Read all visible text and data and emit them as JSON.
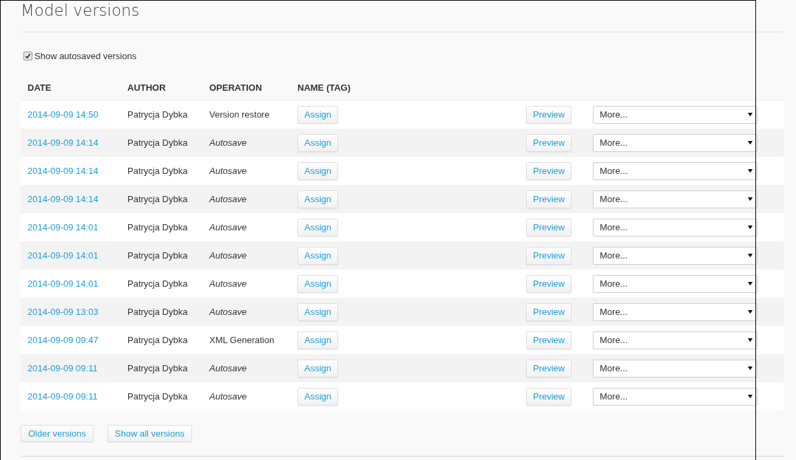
{
  "title": "Model versions",
  "autosave_toggle": {
    "label": "Show autosaved versions",
    "checked": true
  },
  "table": {
    "columns": [
      "DATE",
      "AUTHOR",
      "OPERATION",
      "NAME (TAG)"
    ],
    "rows": [
      {
        "date": "2014-09-09 14:50",
        "author": "Patrycja Dybka",
        "operation": "Version restore",
        "kind": "manual",
        "assign": "Assign",
        "preview": "Preview",
        "more": "More..."
      },
      {
        "date": "2014-09-09 14:14",
        "author": "Patrycja Dybka",
        "operation": "Autosave",
        "kind": "autosave",
        "assign": "Assign",
        "preview": "Preview",
        "more": "More..."
      },
      {
        "date": "2014-09-09 14:14",
        "author": "Patrycja Dybka",
        "operation": "Autosave",
        "kind": "autosave",
        "assign": "Assign",
        "preview": "Preview",
        "more": "More..."
      },
      {
        "date": "2014-09-09 14:14",
        "author": "Patrycja Dybka",
        "operation": "Autosave",
        "kind": "autosave",
        "assign": "Assign",
        "preview": "Preview",
        "more": "More..."
      },
      {
        "date": "2014-09-09 14:01",
        "author": "Patrycja Dybka",
        "operation": "Autosave",
        "kind": "autosave",
        "assign": "Assign",
        "preview": "Preview",
        "more": "More..."
      },
      {
        "date": "2014-09-09 14:01",
        "author": "Patrycja Dybka",
        "operation": "Autosave",
        "kind": "autosave",
        "assign": "Assign",
        "preview": "Preview",
        "more": "More..."
      },
      {
        "date": "2014-09-09 14:01",
        "author": "Patrycja Dybka",
        "operation": "Autosave",
        "kind": "autosave",
        "assign": "Assign",
        "preview": "Preview",
        "more": "More..."
      },
      {
        "date": "2014-09-09 13:03",
        "author": "Patrycja Dybka",
        "operation": "Autosave",
        "kind": "autosave",
        "assign": "Assign",
        "preview": "Preview",
        "more": "More..."
      },
      {
        "date": "2014-09-09 09:47",
        "author": "Patrycja Dybka",
        "operation": "XML Generation",
        "kind": "manual",
        "assign": "Assign",
        "preview": "Preview",
        "more": "More..."
      },
      {
        "date": "2014-09-09 09:11",
        "author": "Patrycja Dybka",
        "operation": "Autosave",
        "kind": "autosave",
        "assign": "Assign",
        "preview": "Preview",
        "more": "More..."
      },
      {
        "date": "2014-09-09 09:11",
        "author": "Patrycja Dybka",
        "operation": "Autosave",
        "kind": "autosave",
        "assign": "Assign",
        "preview": "Preview",
        "more": "More..."
      }
    ]
  },
  "buttons": [
    "Older versions",
    "Show all versions"
  ]
}
